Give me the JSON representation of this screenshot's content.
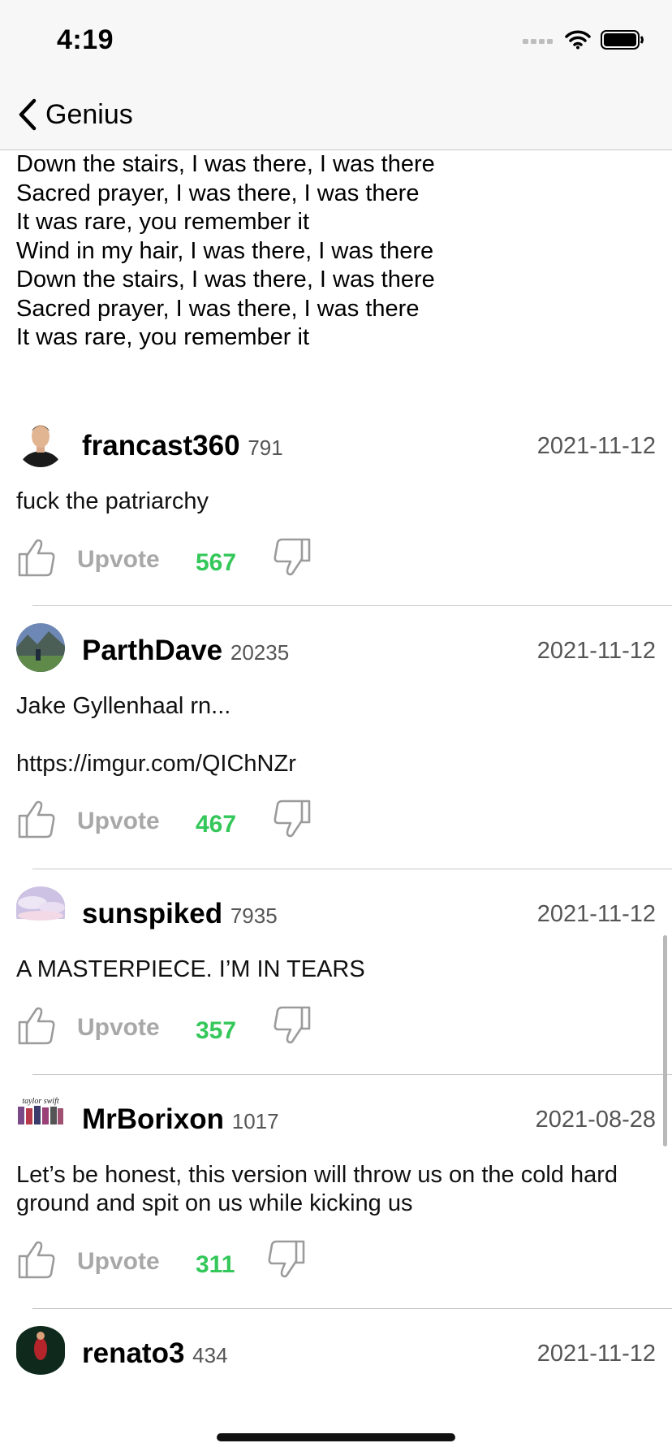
{
  "status": {
    "time": "4:19"
  },
  "nav": {
    "back_label": "Genius"
  },
  "lyrics": [
    "Down the stairs, I was there, I was there",
    "Sacred prayer, I was there, I was there",
    "It was rare, you remember it",
    "Wind in my hair, I was there, I was there",
    "Down the stairs, I was there, I was there",
    "Sacred prayer, I was there, I was there",
    "It was rare, you remember it"
  ],
  "comments": [
    {
      "username": "francast360",
      "score": "791",
      "date": "2021-11-12",
      "text": [
        "fuck the patriarchy"
      ],
      "upvote_label": "Upvote",
      "votes": "567"
    },
    {
      "username": "ParthDave",
      "score": "20235",
      "date": "2021-11-12",
      "text": [
        "Jake Gyllenhaal rn...",
        "https://imgur.com/QIChNZr"
      ],
      "upvote_label": "Upvote",
      "votes": "467"
    },
    {
      "username": "sunspiked",
      "score": "7935",
      "date": "2021-11-12",
      "text": [
        "A MASTERPIECE. I’M IN TEARS"
      ],
      "upvote_label": "Upvote",
      "votes": "357"
    },
    {
      "username": "MrBorixon",
      "score": "1017",
      "date": "2021-08-28",
      "text": [
        "Let’s be honest, this version will throw us on the cold hard ground and spit on us while kicking us"
      ],
      "upvote_label": "Upvote",
      "votes": "311",
      "avatar_text": "taylor swift"
    },
    {
      "username": "renato3",
      "score": "434",
      "date": "2021-11-12",
      "text": []
    }
  ],
  "colors": {
    "vote_count": "#34c759",
    "upvote_label": "#a8a8a8",
    "date": "#555555"
  }
}
